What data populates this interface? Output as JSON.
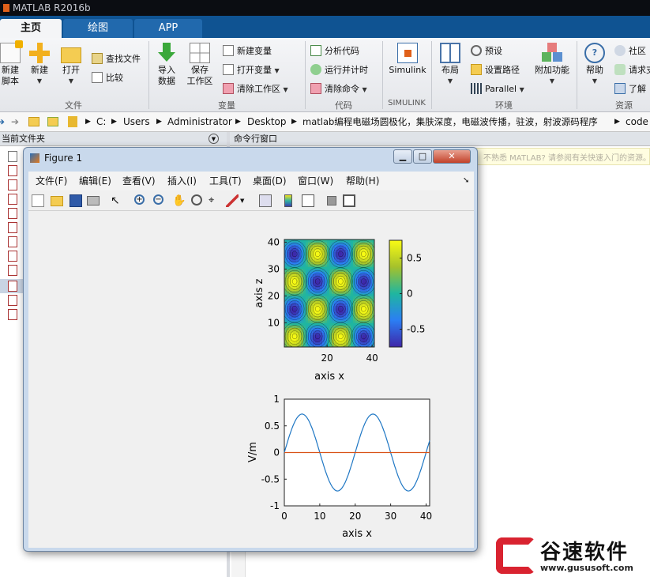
{
  "app": {
    "title": "MATLAB R2016b"
  },
  "tabs": [
    {
      "label": "主页"
    },
    {
      "label": "绘图"
    },
    {
      "label": "APP"
    }
  ],
  "ribbon": {
    "file": {
      "new_script": "新建\n脚本",
      "new": "新建",
      "open": "打开",
      "find_files": "查找文件",
      "compare": "比较",
      "section": "文件"
    },
    "variable": {
      "import": "导入\n数据",
      "save_ws": "保存\n工作区",
      "new_var": "新建变量",
      "open_var": "打开变量",
      "clear_ws": "清除工作区",
      "section": "变量"
    },
    "code": {
      "analyze": "分析代码",
      "run_time": "运行并计时",
      "clear_cmd": "清除命令",
      "section": "代码"
    },
    "simulink": {
      "label": "Simulink",
      "section": "SIMULINK"
    },
    "env": {
      "layout": "布局",
      "prefs": "预设",
      "set_path": "设置路径",
      "parallel": "Parallel",
      "addons": "附加功能",
      "section": "环境"
    },
    "resources": {
      "help": "帮助",
      "community": "社区",
      "request": "请求支",
      "learn": "了解",
      "section": "资源"
    }
  },
  "path": {
    "segments": [
      "C:",
      "Users",
      "Administrator",
      "Desktop",
      "matlab编程电磁场圆极化，集肤深度，电磁波传播，驻波，射波源码程序",
      "code"
    ]
  },
  "panels": {
    "current_folder": "当前文件夹",
    "command_window": "命令行窗口",
    "hint": "不熟悉 MATLAB? 请参阅有关快速入门的资源。"
  },
  "figure": {
    "title": "Figure 1",
    "menu": [
      "文件(F)",
      "编辑(E)",
      "查看(V)",
      "插入(I)",
      "工具(T)",
      "桌面(D)",
      "窗口(W)",
      "帮助(H)"
    ],
    "tools": [
      "new-figure-icon",
      "open-file-icon",
      "save-icon",
      "print-icon",
      "pointer-icon",
      "zoom-in-icon",
      "zoom-out-icon",
      "pan-icon",
      "rotate-3d-icon",
      "data-cursor-icon",
      "brush-icon",
      "link-plot-icon",
      "colorbar-icon",
      "legend-icon",
      "hide-plot-tools-icon",
      "show-plot-tools-icon"
    ]
  },
  "chart_data": [
    {
      "type": "heatmap",
      "xlabel": "axis x",
      "ylabel": "axis z",
      "xticks": [
        20,
        40
      ],
      "yticks": [
        10,
        20,
        30,
        40
      ],
      "xlim": [
        1,
        41
      ],
      "ylim": [
        1,
        41
      ],
      "colormap": "parula",
      "colorbar": {
        "ticks": [
          0.5,
          0,
          -0.5
        ],
        "range": [
          -0.75,
          0.75
        ]
      },
      "contours": true
    },
    {
      "type": "line",
      "xlabel": "axis x",
      "ylabel": "V/m",
      "xlim": [
        0,
        41
      ],
      "ylim": [
        -1,
        1
      ],
      "xticks": [
        0,
        10,
        20,
        30,
        40
      ],
      "yticks": [
        1,
        0.5,
        0,
        -0.5,
        -1
      ],
      "series": [
        {
          "x": [
            0,
            2,
            4,
            5,
            6,
            8,
            10,
            12,
            14,
            15,
            16,
            18,
            20,
            22,
            24,
            25,
            26,
            28,
            30,
            32,
            34,
            35,
            36,
            38,
            40,
            41
          ],
          "values": [
            0,
            0.45,
            0.69,
            0.72,
            0.69,
            0.45,
            0,
            -0.45,
            -0.69,
            -0.72,
            -0.69,
            -0.45,
            0,
            0.45,
            0.69,
            0.72,
            0.69,
            0.45,
            0,
            -0.45,
            -0.69,
            -0.72,
            -0.69,
            -0.45,
            0,
            0.02
          ],
          "color": "#1f77c4"
        },
        {
          "x": [
            0,
            41
          ],
          "values": [
            0,
            0
          ],
          "color": "#d95319"
        }
      ]
    }
  ],
  "watermark": {
    "brand": "谷速软件",
    "url": "www.gususoft.com"
  },
  "colors": {
    "tab_blue": "#0f5392",
    "accent": "#d92330"
  }
}
